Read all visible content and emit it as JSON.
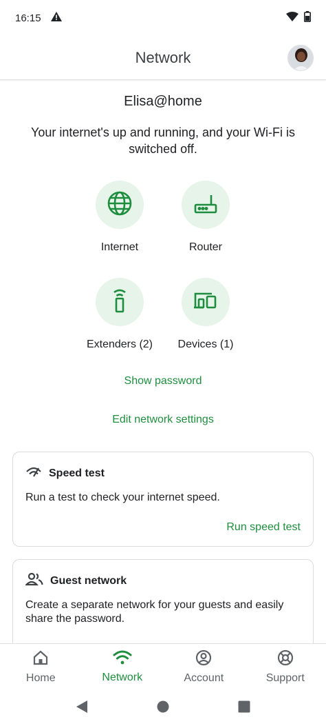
{
  "status_bar": {
    "time": "16:15",
    "icons": [
      "alert-icon",
      "wifi-icon",
      "battery-icon"
    ]
  },
  "app_bar": {
    "title": "Network",
    "avatar": "avatar"
  },
  "network": {
    "name": "Elisa@home",
    "status": "Your internet's up and running, and your Wi-Fi is switched off."
  },
  "tiles": [
    {
      "label": "Internet",
      "icon": "globe-icon"
    },
    {
      "label": "Router",
      "icon": "router-icon"
    },
    {
      "label": "Extenders (2)",
      "icon": "extender-icon"
    },
    {
      "label": "Devices (1)",
      "icon": "devices-icon"
    }
  ],
  "links": {
    "show_password": "Show password",
    "edit_settings": "Edit network settings"
  },
  "speed_test": {
    "title": "Speed test",
    "body": "Run a test to check your internet speed.",
    "action": "Run speed test"
  },
  "guest_network": {
    "title": "Guest network",
    "body": "Create a separate network for your guests and easily share the password."
  },
  "bottom_nav": [
    {
      "label": "Home",
      "icon": "home-icon",
      "active": false
    },
    {
      "label": "Network",
      "icon": "wifi-icon",
      "active": true
    },
    {
      "label": "Account",
      "icon": "account-icon",
      "active": false
    },
    {
      "label": "Support",
      "icon": "support-icon",
      "active": false
    }
  ],
  "colors": {
    "accent": "#1e8e3e",
    "tile_bg": "#e6f4ea",
    "text": "#202124",
    "muted": "#5f6368"
  }
}
